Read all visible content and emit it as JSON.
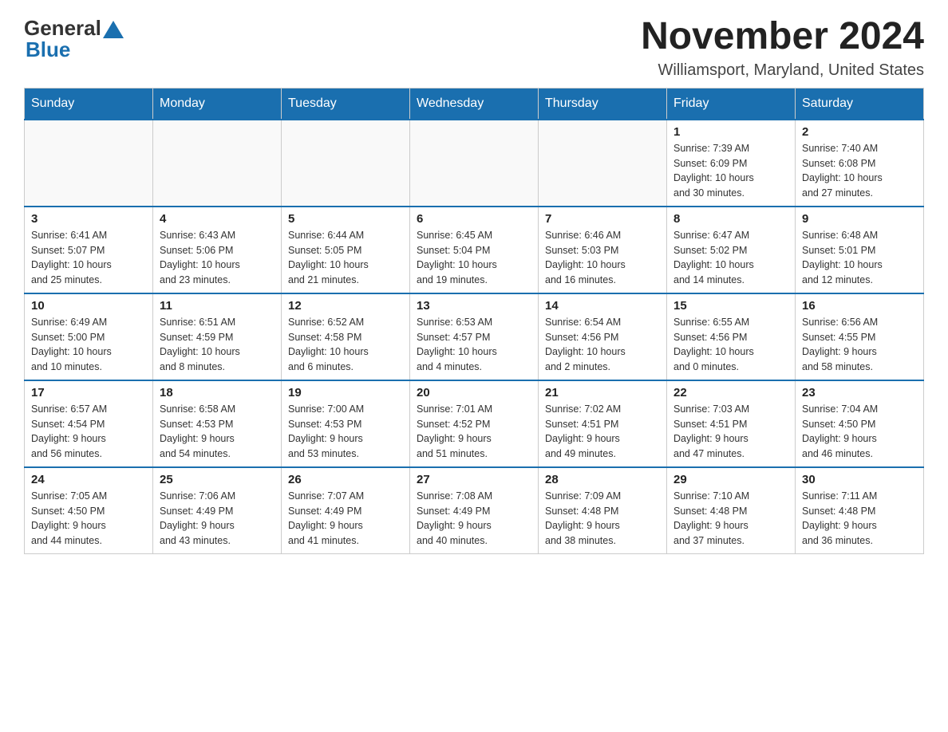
{
  "header": {
    "logo_general": "General",
    "logo_blue": "Blue",
    "month_title": "November 2024",
    "location": "Williamsport, Maryland, United States"
  },
  "days_of_week": [
    "Sunday",
    "Monday",
    "Tuesday",
    "Wednesday",
    "Thursday",
    "Friday",
    "Saturday"
  ],
  "weeks": [
    {
      "days": [
        {
          "number": "",
          "info": ""
        },
        {
          "number": "",
          "info": ""
        },
        {
          "number": "",
          "info": ""
        },
        {
          "number": "",
          "info": ""
        },
        {
          "number": "",
          "info": ""
        },
        {
          "number": "1",
          "info": "Sunrise: 7:39 AM\nSunset: 6:09 PM\nDaylight: 10 hours\nand 30 minutes."
        },
        {
          "number": "2",
          "info": "Sunrise: 7:40 AM\nSunset: 6:08 PM\nDaylight: 10 hours\nand 27 minutes."
        }
      ]
    },
    {
      "days": [
        {
          "number": "3",
          "info": "Sunrise: 6:41 AM\nSunset: 5:07 PM\nDaylight: 10 hours\nand 25 minutes."
        },
        {
          "number": "4",
          "info": "Sunrise: 6:43 AM\nSunset: 5:06 PM\nDaylight: 10 hours\nand 23 minutes."
        },
        {
          "number": "5",
          "info": "Sunrise: 6:44 AM\nSunset: 5:05 PM\nDaylight: 10 hours\nand 21 minutes."
        },
        {
          "number": "6",
          "info": "Sunrise: 6:45 AM\nSunset: 5:04 PM\nDaylight: 10 hours\nand 19 minutes."
        },
        {
          "number": "7",
          "info": "Sunrise: 6:46 AM\nSunset: 5:03 PM\nDaylight: 10 hours\nand 16 minutes."
        },
        {
          "number": "8",
          "info": "Sunrise: 6:47 AM\nSunset: 5:02 PM\nDaylight: 10 hours\nand 14 minutes."
        },
        {
          "number": "9",
          "info": "Sunrise: 6:48 AM\nSunset: 5:01 PM\nDaylight: 10 hours\nand 12 minutes."
        }
      ]
    },
    {
      "days": [
        {
          "number": "10",
          "info": "Sunrise: 6:49 AM\nSunset: 5:00 PM\nDaylight: 10 hours\nand 10 minutes."
        },
        {
          "number": "11",
          "info": "Sunrise: 6:51 AM\nSunset: 4:59 PM\nDaylight: 10 hours\nand 8 minutes."
        },
        {
          "number": "12",
          "info": "Sunrise: 6:52 AM\nSunset: 4:58 PM\nDaylight: 10 hours\nand 6 minutes."
        },
        {
          "number": "13",
          "info": "Sunrise: 6:53 AM\nSunset: 4:57 PM\nDaylight: 10 hours\nand 4 minutes."
        },
        {
          "number": "14",
          "info": "Sunrise: 6:54 AM\nSunset: 4:56 PM\nDaylight: 10 hours\nand 2 minutes."
        },
        {
          "number": "15",
          "info": "Sunrise: 6:55 AM\nSunset: 4:56 PM\nDaylight: 10 hours\nand 0 minutes."
        },
        {
          "number": "16",
          "info": "Sunrise: 6:56 AM\nSunset: 4:55 PM\nDaylight: 9 hours\nand 58 minutes."
        }
      ]
    },
    {
      "days": [
        {
          "number": "17",
          "info": "Sunrise: 6:57 AM\nSunset: 4:54 PM\nDaylight: 9 hours\nand 56 minutes."
        },
        {
          "number": "18",
          "info": "Sunrise: 6:58 AM\nSunset: 4:53 PM\nDaylight: 9 hours\nand 54 minutes."
        },
        {
          "number": "19",
          "info": "Sunrise: 7:00 AM\nSunset: 4:53 PM\nDaylight: 9 hours\nand 53 minutes."
        },
        {
          "number": "20",
          "info": "Sunrise: 7:01 AM\nSunset: 4:52 PM\nDaylight: 9 hours\nand 51 minutes."
        },
        {
          "number": "21",
          "info": "Sunrise: 7:02 AM\nSunset: 4:51 PM\nDaylight: 9 hours\nand 49 minutes."
        },
        {
          "number": "22",
          "info": "Sunrise: 7:03 AM\nSunset: 4:51 PM\nDaylight: 9 hours\nand 47 minutes."
        },
        {
          "number": "23",
          "info": "Sunrise: 7:04 AM\nSunset: 4:50 PM\nDaylight: 9 hours\nand 46 minutes."
        }
      ]
    },
    {
      "days": [
        {
          "number": "24",
          "info": "Sunrise: 7:05 AM\nSunset: 4:50 PM\nDaylight: 9 hours\nand 44 minutes."
        },
        {
          "number": "25",
          "info": "Sunrise: 7:06 AM\nSunset: 4:49 PM\nDaylight: 9 hours\nand 43 minutes."
        },
        {
          "number": "26",
          "info": "Sunrise: 7:07 AM\nSunset: 4:49 PM\nDaylight: 9 hours\nand 41 minutes."
        },
        {
          "number": "27",
          "info": "Sunrise: 7:08 AM\nSunset: 4:49 PM\nDaylight: 9 hours\nand 40 minutes."
        },
        {
          "number": "28",
          "info": "Sunrise: 7:09 AM\nSunset: 4:48 PM\nDaylight: 9 hours\nand 38 minutes."
        },
        {
          "number": "29",
          "info": "Sunrise: 7:10 AM\nSunset: 4:48 PM\nDaylight: 9 hours\nand 37 minutes."
        },
        {
          "number": "30",
          "info": "Sunrise: 7:11 AM\nSunset: 4:48 PM\nDaylight: 9 hours\nand 36 minutes."
        }
      ]
    }
  ]
}
